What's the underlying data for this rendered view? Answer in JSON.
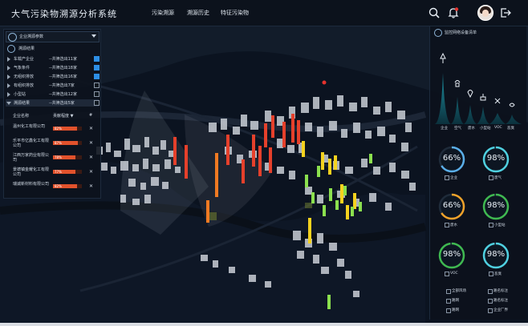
{
  "app": {
    "title": "大气污染物溯源分析系统"
  },
  "nav": [
    {
      "label": "污染溯源"
    },
    {
      "label": "溯源历史"
    },
    {
      "label": "特征污染物"
    }
  ],
  "toolbar": {
    "icons": [
      "search-icon",
      "bell-icon",
      "avatar",
      "logout-icon"
    ],
    "notification": true
  },
  "left_panel": {
    "dropdown": {
      "label": "企业溯源参数"
    },
    "section_title": "溯源结果",
    "sources": [
      {
        "name": "车载产企业",
        "count": "--共筛选出11家",
        "checked": true,
        "expanded": false
      },
      {
        "name": "气象条件",
        "count": "--共筛选出18家",
        "checked": true,
        "expanded": false
      },
      {
        "name": "无组织排放",
        "count": "--共筛选出16家",
        "checked": true,
        "expanded": false
      },
      {
        "name": "有组织排放",
        "count": "--共筛选出7家",
        "checked": false,
        "expanded": false
      },
      {
        "name": "小型站",
        "count": "--共筛选出12家",
        "checked": false,
        "expanded": false
      },
      {
        "name": "溯源结果",
        "count": "--共筛选出5家",
        "checked": false,
        "expanded": true
      }
    ],
    "table": {
      "col1": "企业名称",
      "col2": "贡献程度 ▼",
      "col3": "#"
    },
    "enterprises": [
      {
        "name": "温州化工有限公司",
        "pct": "82%",
        "value": 0.82
      },
      {
        "name": "乐平市亿鑫化工有限公司",
        "pct": "87%",
        "value": 0.87
      },
      {
        "name": "江西万家药业有限公司",
        "pct": "78%",
        "value": 0.78
      },
      {
        "name": "景德镇金耀化工有限公司",
        "pct": "77%",
        "value": 0.77
      },
      {
        "name": "瑞诚新材料有限公司",
        "pct": "82%",
        "value": 0.82
      }
    ]
  },
  "right_panel": {
    "title": "监控网络设备清单",
    "mountain_labels": [
      "企业",
      "空气",
      "废水",
      "小型站",
      "VOC",
      "恶臭"
    ],
    "gauges": [
      {
        "value": "66%",
        "label": "企业",
        "color": "#5aaee8",
        "fraction": 0.66
      },
      {
        "value": "98%",
        "label": "废气",
        "color": "#4fd0e0",
        "fraction": 0.98
      },
      {
        "value": "66%",
        "label": "废水",
        "color": "#f0a22a",
        "fraction": 0.66
      },
      {
        "value": "98%",
        "label": "小型站",
        "color": "#3fb950",
        "fraction": 0.98
      },
      {
        "value": "98%",
        "label": "VOC",
        "color": "#3fb950",
        "fraction": 0.98
      },
      {
        "value": "98%",
        "label": "恶臭",
        "color": "#4fd0e0",
        "fraction": 0.98
      }
    ],
    "options": [
      "全部风场",
      "路网",
      "路网",
      "路名标注",
      "路名标注",
      "企业厂界"
    ]
  }
}
